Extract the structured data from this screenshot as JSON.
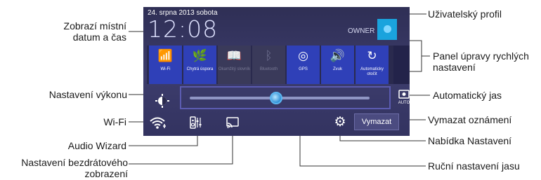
{
  "status": {
    "date": "24. srpna 2013 sobota",
    "time": "12:08",
    "owner": "OWNER"
  },
  "quick_settings": [
    {
      "label": "Wi-Fi",
      "icon": "wifi-icon",
      "enabled": true
    },
    {
      "label": "Chytrá úspora",
      "icon": "smart-saving-icon",
      "enabled": true
    },
    {
      "label": "Okamžitý slovník",
      "icon": "dictionary-icon",
      "enabled": false
    },
    {
      "label": "Bluetooth",
      "icon": "bluetooth-icon",
      "enabled": false
    },
    {
      "label": "GPS",
      "icon": "gps-icon",
      "enabled": true
    },
    {
      "label": "Zvuk",
      "icon": "sound-icon",
      "enabled": true
    },
    {
      "label": "Automaticky otočit",
      "icon": "auto-rotate-icon",
      "enabled": true
    }
  ],
  "brightness": {
    "level": 0.48
  },
  "buttons": {
    "clear": "Vymazat"
  },
  "callouts": {
    "datetime_line1": "Zobrazí místní",
    "datetime_line2": "datum a čas",
    "performance": "Nastavení výkonu",
    "wifi": "Wi-Fi",
    "audio_wizard": "Audio Wizard",
    "wireless_line1": "Nastavení bezdrátového",
    "wireless_line2": "zobrazení",
    "user_profile": "Uživatelský profil",
    "quick_panel_line1": "Panel úpravy rychlých",
    "quick_panel_line2": "nastavení",
    "auto_brightness": "Automatický jas",
    "clear_notifications": "Vymazat oznámení",
    "settings_menu": "Nabídka Nastavení",
    "manual_brightness": "Ruční nastavení jasu"
  },
  "colors": {
    "panel": "#34345f",
    "tile_on": "#2f40b8",
    "accent": "#1aa3dd"
  }
}
